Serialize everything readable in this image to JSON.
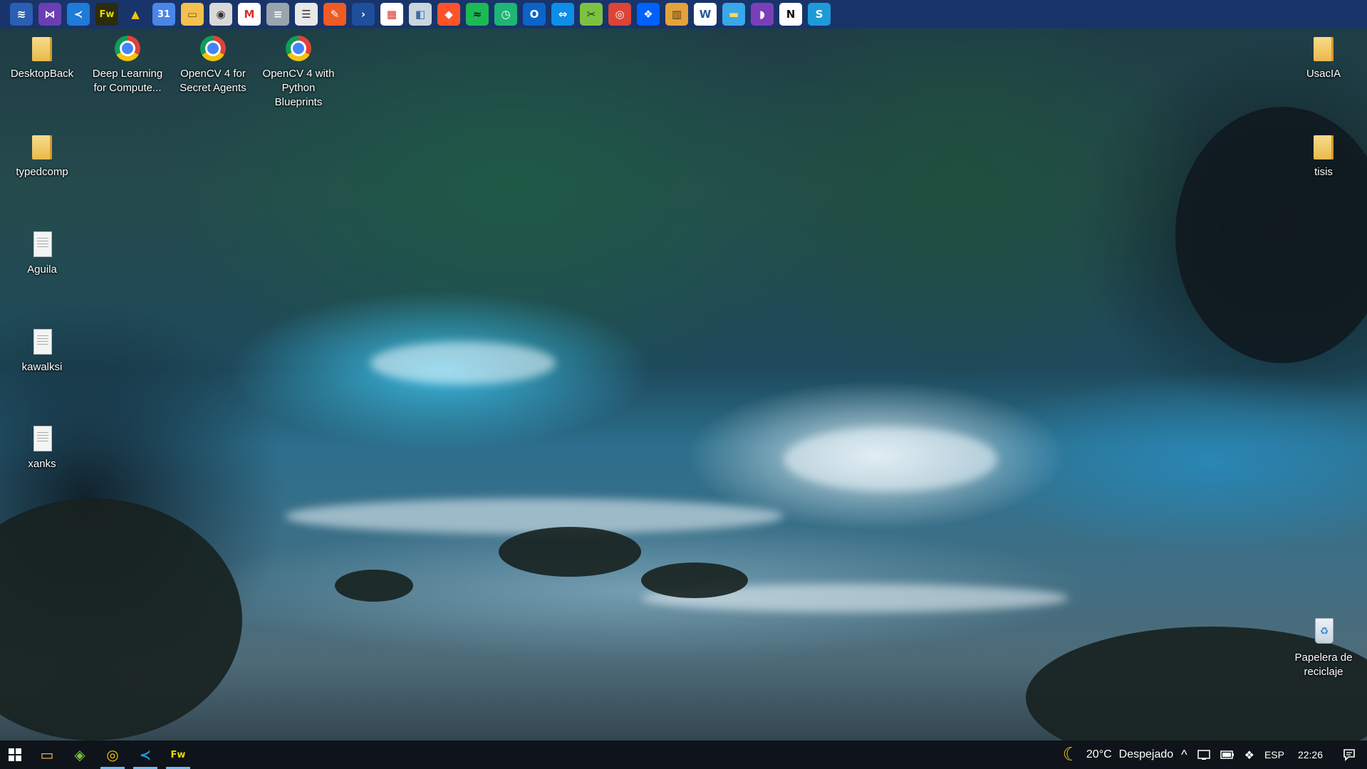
{
  "quick_launch": {
    "icons": [
      {
        "name": "desktop-stack-icon",
        "glyph": "≋",
        "bg": "#2a5fb3",
        "fg": "#ffffff"
      },
      {
        "name": "visual-studio-icon",
        "glyph": "⋈",
        "bg": "#6b3fb3",
        "fg": "#ffffff"
      },
      {
        "name": "vscode-icon",
        "glyph": "≺",
        "bg": "#1f7ad8",
        "fg": "#ffffff"
      },
      {
        "name": "fireworks-icon",
        "glyph": "Fw",
        "bg": "#2b2b10",
        "fg": "#e8d800"
      },
      {
        "name": "google-drive-icon",
        "glyph": "▲",
        "bg": "#18346a",
        "fg": "#f4c20d"
      },
      {
        "name": "calendar-31-icon",
        "glyph": "31",
        "bg": "#4a86e8",
        "fg": "#ffffff"
      },
      {
        "name": "file-explorer-icon",
        "glyph": "▭",
        "bg": "#f2c14e",
        "fg": "#7a5a10"
      },
      {
        "name": "github-desktop-icon",
        "glyph": "◉",
        "bg": "#d9d9d9",
        "fg": "#333333"
      },
      {
        "name": "gmail-icon",
        "glyph": "M",
        "bg": "#ffffff",
        "fg": "#d93025"
      },
      {
        "name": "database-icon",
        "glyph": "≡",
        "bg": "#9aa4ad",
        "fg": "#ffffff"
      },
      {
        "name": "notepad-icon",
        "glyph": "☰",
        "bg": "#e8e8e8",
        "fg": "#333333"
      },
      {
        "name": "postman-icon",
        "glyph": "✎",
        "bg": "#ef5b25",
        "fg": "#ffffff"
      },
      {
        "name": "powershell-icon",
        "glyph": "›",
        "bg": "#1e4f9c",
        "fg": "#ffffff"
      },
      {
        "name": "calendar-app-icon",
        "glyph": "▦",
        "bg": "#ffffff",
        "fg": "#d93025"
      },
      {
        "name": "android-studio-icon",
        "glyph": "◧",
        "bg": "#c9d6de",
        "fg": "#3a6ea5"
      },
      {
        "name": "brave-icon",
        "glyph": "◆",
        "bg": "#fb542b",
        "fg": "#ffffff"
      },
      {
        "name": "spotify-icon",
        "glyph": "≈",
        "bg": "#1db954",
        "fg": "#0e1419"
      },
      {
        "name": "clock-app-icon",
        "glyph": "◷",
        "bg": "#1fb575",
        "fg": "#ffffff"
      },
      {
        "name": "outlook-icon",
        "glyph": "O",
        "bg": "#0a64c9",
        "fg": "#ffffff"
      },
      {
        "name": "teamviewer-icon",
        "glyph": "⇔",
        "bg": "#0e8ee9",
        "fg": "#ffffff"
      },
      {
        "name": "greenshot-icon",
        "glyph": "✂",
        "bg": "#7cc242",
        "fg": "#1d3a10"
      },
      {
        "name": "chrome-icon",
        "glyph": "◎",
        "bg": "#db4437",
        "fg": "#ffffff"
      },
      {
        "name": "dropbox-icon",
        "glyph": "❖",
        "bg": "#0061fe",
        "fg": "#ffffff"
      },
      {
        "name": "library-books-icon",
        "glyph": "▥",
        "bg": "#e4a23c",
        "fg": "#5a3a10"
      },
      {
        "name": "word-icon",
        "glyph": "W",
        "bg": "#ffffff",
        "fg": "#2b579a"
      },
      {
        "name": "folder-desktop-icon",
        "glyph": "▬",
        "bg": "#3aa7e8",
        "fg": "#f8d860"
      },
      {
        "name": "podcast-icon",
        "glyph": "◗",
        "bg": "#7a3fb8",
        "fg": "#ffffff"
      },
      {
        "name": "notion-icon",
        "glyph": "N",
        "bg": "#ffffff",
        "fg": "#111111"
      },
      {
        "name": "swift-s-icon",
        "glyph": "S",
        "bg": "#1f9ad8",
        "fg": "#ffffff"
      }
    ]
  },
  "desktop": {
    "left": [
      {
        "name": "desktop-icon-desktopback",
        "type": "folder",
        "label": "DesktopBack"
      },
      {
        "name": "desktop-icon-deep-learning",
        "type": "chrome",
        "label": "Deep Learning for Compute..."
      },
      {
        "name": "desktop-icon-opencv-secret-agents",
        "type": "chrome",
        "label": "OpenCV 4 for Secret Agents"
      },
      {
        "name": "desktop-icon-opencv-blueprints",
        "type": "chrome",
        "label": "OpenCV 4 with Python Blueprints"
      },
      {
        "name": "desktop-icon-typedcomp",
        "type": "folder",
        "label": "typedcomp"
      },
      {
        "name": "desktop-icon-aguila",
        "type": "doc",
        "label": "Aguila"
      },
      {
        "name": "desktop-icon-kawalksi",
        "type": "doc",
        "label": "kawalksi"
      },
      {
        "name": "desktop-icon-xanks",
        "type": "doc",
        "label": "xanks"
      }
    ],
    "right": [
      {
        "name": "desktop-icon-usacia",
        "type": "folder",
        "label": "UsacIA"
      },
      {
        "name": "desktop-icon-tisis",
        "type": "folder",
        "label": "tisis"
      },
      {
        "name": "desktop-icon-recycle-bin",
        "type": "recycle",
        "label": "Papelera de reciclaje"
      }
    ]
  },
  "taskbar": {
    "pinned": [
      {
        "name": "taskbar-file-explorer",
        "glyph": "▭",
        "color": "#f2c14e",
        "active": false
      },
      {
        "name": "taskbar-3d-app",
        "glyph": "◈",
        "color": "#7cc242",
        "active": false
      },
      {
        "name": "taskbar-chrome",
        "glyph": "◎",
        "color": "#f4c20d",
        "active": true
      },
      {
        "name": "taskbar-vscode",
        "glyph": "≺",
        "color": "#1f9ad8",
        "active": true
      },
      {
        "name": "taskbar-fireworks",
        "glyph": "Fw",
        "color": "#e8d800",
        "active": true
      }
    ],
    "weather": {
      "icon": "moon-icon",
      "glyph": "☾",
      "temp": "20°C",
      "condition": "Despejado"
    },
    "tray": {
      "chevron": "^",
      "language": "ESP",
      "time": "22:26"
    }
  }
}
